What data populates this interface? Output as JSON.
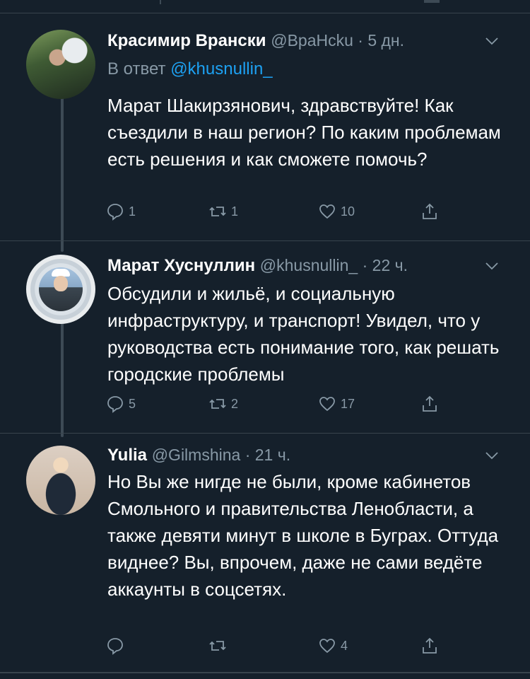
{
  "tweets": [
    {
      "name": "Красимир Врански",
      "meta": "@ВраНcku · 5 дн.",
      "reply_prefix": "В ответ ",
      "reply_handle": "@khusnullin_",
      "text": "Марат Шакирзянович, здравствуйте! Как съездили в наш регион? По каким проблемам есть решения и как сможете помочь?",
      "replies": "1",
      "retweets": "1",
      "likes": "10"
    },
    {
      "name": "Марат Хуснуллин",
      "meta": "@khusnullin_ · 22 ч.",
      "text": "Обсудили и жильё, и социальную инфраструктуру, и транспорт! Увидел, что у руководства есть понимание того, как решать городские проблемы",
      "replies": "5",
      "retweets": "2",
      "likes": "17"
    },
    {
      "name": "Yulia",
      "meta": "@Gilmshina · 21 ч.",
      "text": "Но Вы же нигде не были, кроме кабинетов Смольного и правительства Ленобласти, а также девяти минут в школе в Буграх. Оттуда виднее? Вы, впрочем, даже не сами ведёте аккаунты в соцсетях.",
      "replies": "",
      "retweets": "",
      "likes": "4"
    }
  ],
  "icons": {
    "reply": "reply-icon",
    "retweet": "retweet-icon",
    "like": "heart-icon",
    "share": "share-icon",
    "menu": "chevron-down-icon"
  },
  "colors": {
    "background": "#15202b",
    "secondary_text": "#8899a6",
    "link": "#1da1f2",
    "divider": "#38444d"
  }
}
